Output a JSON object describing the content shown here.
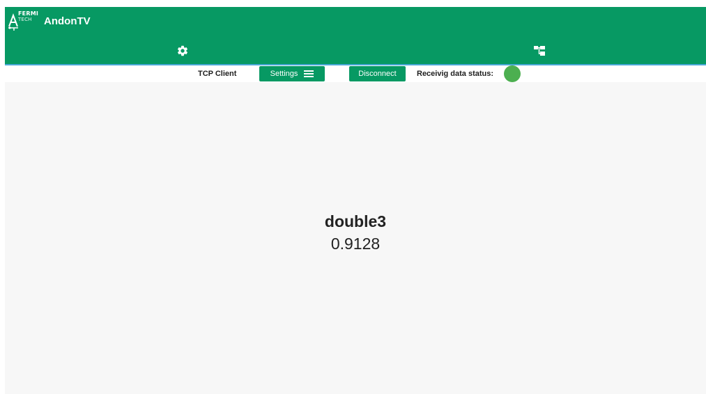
{
  "header": {
    "logo_line1": "FERMI",
    "logo_line2": "TECH",
    "title": "AndonTV",
    "nav": [
      {
        "icon": "gear-icon"
      },
      {
        "icon": "tree-structure-icon"
      }
    ],
    "bg_color": "#079963"
  },
  "toolbar": {
    "connection_type": "TCP Client",
    "settings_label": "Settings",
    "disconnect_label": "Disconnect",
    "status_label": "Receivig data status:",
    "status_color": "#4caf50"
  },
  "main": {
    "variable_name": "double3",
    "variable_value": "0.9128"
  }
}
